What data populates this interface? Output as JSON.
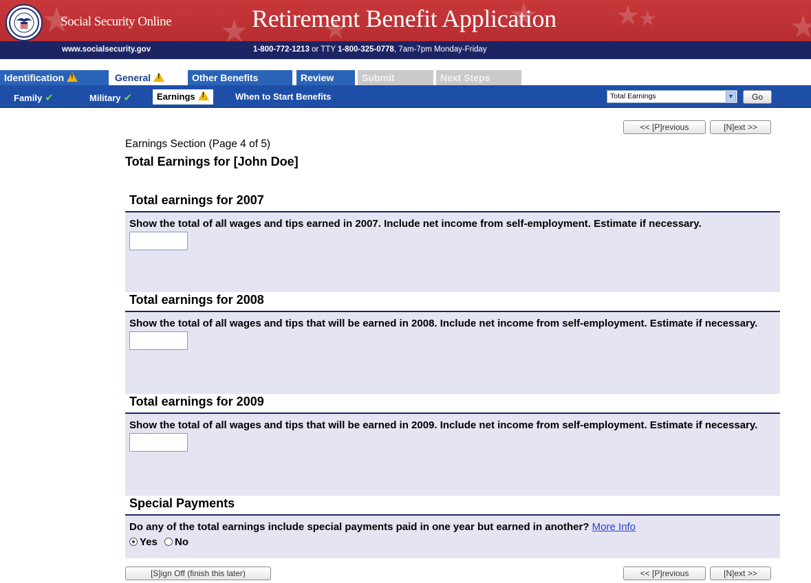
{
  "header": {
    "site_name": "Social Security Online",
    "app_title": "Retirement Benefit Application",
    "url": "www.socialsecurity.gov",
    "phone_main": "1-800-772-1213",
    "phone_or": " or TTY ",
    "phone_tty": "1-800-325-0778",
    "phone_hours": ", 7am-7pm Monday-Friday",
    "seal_text": "SOCIAL SECURITY ADMINISTRATION",
    "seal_center": "USA"
  },
  "tabs": [
    {
      "label": "Identification",
      "warning": true
    },
    {
      "label": "General",
      "warning": true
    },
    {
      "label": "Other Benefits"
    },
    {
      "label": "Review"
    },
    {
      "label": "Submit"
    },
    {
      "label": "Next Steps"
    }
  ],
  "subnav": {
    "items": [
      {
        "label": "Family",
        "status": "complete"
      },
      {
        "label": "Military",
        "status": "complete"
      },
      {
        "label": "Earnings",
        "status": "warning"
      },
      {
        "label": "When to Start Benefits"
      }
    ],
    "select_value": "Total Earnings",
    "go_label": "Go"
  },
  "nav": {
    "previous_label": "<< [P]revious",
    "next_label": "[N]ext >>",
    "signoff_label": "[S]ign Off (finish this later)"
  },
  "page": {
    "section_label": "Earnings Section (Page 4 of 5)",
    "heading": "Total Earnings for [John Doe]"
  },
  "questions": [
    {
      "title": "Total earnings for 2007",
      "text": "Show the total of all wages and tips earned in 2007. Include net income from self-employment. Estimate if necessary.",
      "value": ""
    },
    {
      "title": "Total earnings for 2008",
      "text": "Show the total of all wages and tips that will be earned in 2008. Include net income from self-employment. Estimate if necessary.",
      "value": ""
    },
    {
      "title": "Total earnings for 2009",
      "text": "Show the total of all wages and tips that will be earned in 2009. Include net income from self-employment. Estimate if necessary.",
      "value": ""
    }
  ],
  "special": {
    "title": "Special Payments",
    "text": "Do any of the total earnings include special payments paid in one year but earned in another?",
    "more_info": "More Info",
    "yes_label": "Yes",
    "no_label": "No",
    "selected": "Yes"
  },
  "colors": {
    "banner_red": "#c8373a",
    "navy": "#1c2463",
    "tab_blue": "#2a63b8",
    "subnav_blue": "#1e4fa8",
    "question_bg": "#e4e4f2",
    "warning_yellow": "#f2b400",
    "check_green": "#7ad23a"
  }
}
